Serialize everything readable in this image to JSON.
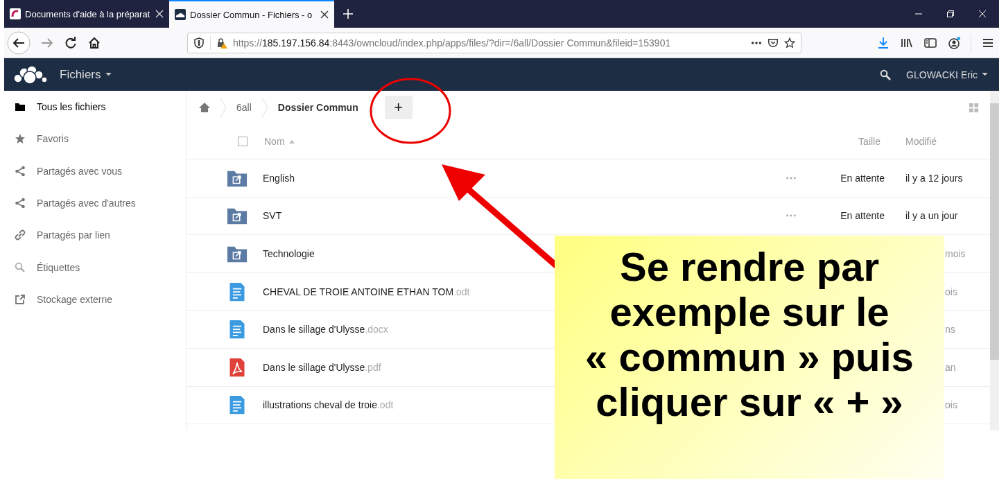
{
  "browser": {
    "tabs": [
      {
        "title": "Documents d'aide à la préparat",
        "selected": false,
        "kind": "school"
      },
      {
        "title": "Dossier Commun - Fichiers - o",
        "selected": true,
        "kind": "cloud"
      }
    ],
    "url": {
      "scheme": "https://",
      "host": "185.197.156.84",
      "rest": ":8443/owncloud/index.php/apps/files/?dir=/6all/Dossier Commun&fileid=153901"
    }
  },
  "header": {
    "app": "Fichiers",
    "user": "GLOWACKI Eric"
  },
  "sidebar": {
    "items": [
      {
        "label": "Tous les fichiers",
        "kind": "folder",
        "selected": true
      },
      {
        "label": "Favoris",
        "kind": "star",
        "selected": false
      },
      {
        "label": "Partagés avec vous",
        "kind": "share",
        "selected": false
      },
      {
        "label": "Partagés avec d'autres",
        "kind": "share",
        "selected": false
      },
      {
        "label": "Partagés par lien",
        "kind": "link",
        "selected": false
      },
      {
        "label": "Étiquettes",
        "kind": "search",
        "selected": false
      },
      {
        "label": "Stockage externe",
        "kind": "external",
        "selected": false
      }
    ]
  },
  "breadcrumb": [
    "6all",
    "Dossier Commun"
  ],
  "add_button": "+",
  "table": {
    "select_all": {
      "checked": false
    },
    "columns": [
      "Nom",
      "Taille",
      "Modifié"
    ],
    "rows": [
      {
        "name": "English",
        "ext": "",
        "kind": "folder",
        "size": "En attente",
        "modified": "il y a 12 jours"
      },
      {
        "name": "SVT",
        "ext": "",
        "kind": "folder",
        "size": "En attente",
        "modified": "il y a un jour"
      },
      {
        "name": "Technologie",
        "ext": "",
        "kind": "folder",
        "modified": "mois"
      },
      {
        "name": "CHEVAL DE TROIE ANTOINE ETHAN TOM",
        "ext": ".odt",
        "kind": "doc",
        "modified": "ois"
      },
      {
        "name": "Dans le sillage d'Ulysse",
        "ext": ".docx",
        "kind": "doc",
        "modified": "ns"
      },
      {
        "name": "Dans le sillage d'Ulysse",
        "ext": ".pdf",
        "kind": "pdf",
        "modified": "an"
      },
      {
        "name": "illustrations cheval de troie",
        "ext": ".odt",
        "kind": "doc",
        "modified": "ois"
      }
    ]
  },
  "callout": "Se rendre par exemple sur le « commun » puis cliquer sur « + »"
}
